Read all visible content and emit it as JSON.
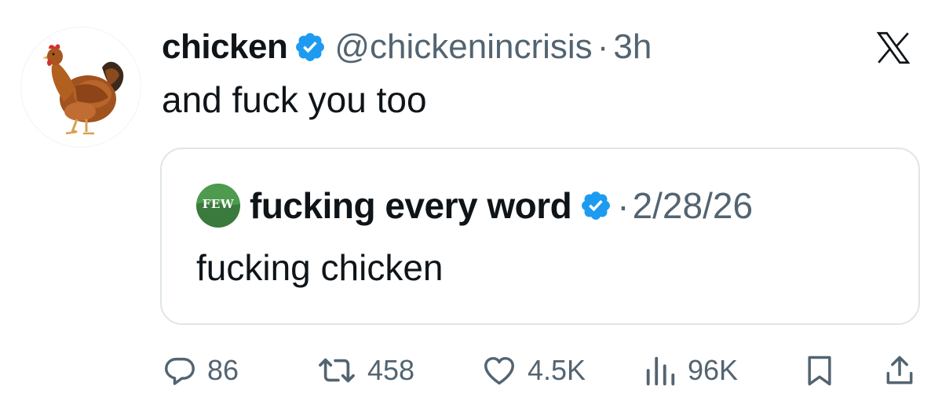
{
  "tweet": {
    "author": {
      "display_name": "chicken",
      "handle": "@chickenincrisis",
      "verified_icon": "verified-badge-icon"
    },
    "separator": "·",
    "time": "3h",
    "text": "and fuck you too",
    "platform_icon": "x-logo-icon"
  },
  "quote": {
    "author": {
      "display_name": "fucking every word",
      "avatar_text": "FEW",
      "verified_icon": "verified-badge-icon"
    },
    "separator": "·",
    "date": "2/28/26",
    "text": "fucking chicken"
  },
  "actions": {
    "replies": "86",
    "retweets": "458",
    "likes": "4.5K",
    "views": "96K",
    "bookmark_icon": "bookmark-icon",
    "share_icon": "share-icon"
  },
  "colors": {
    "verified": "#1d9bf0",
    "secondary_text": "#536471",
    "primary_text": "#0f1419",
    "border": "#dfe5e9",
    "few_avatar_green": "#3a7a3c"
  }
}
